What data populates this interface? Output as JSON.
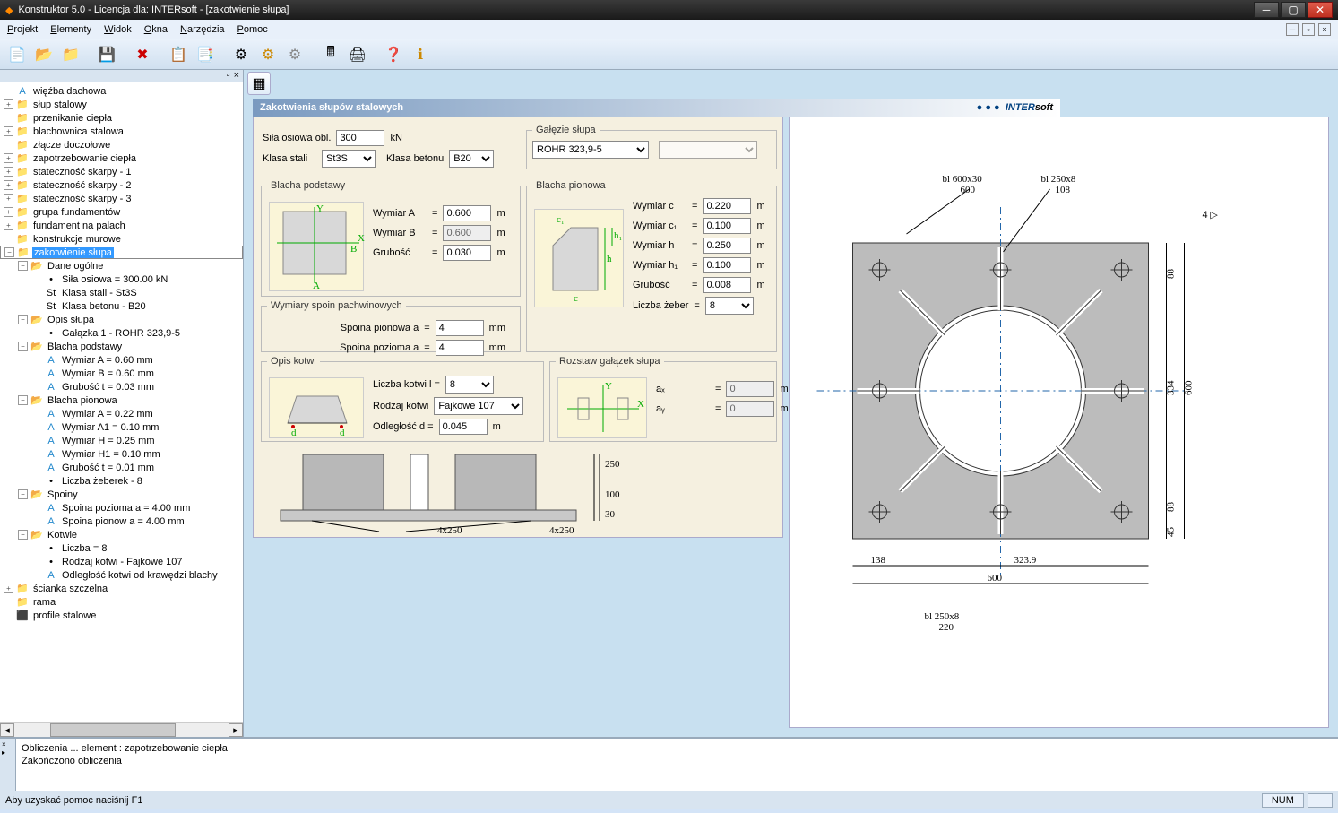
{
  "window": {
    "title": "Konstruktor 5.0 - Licencja dla: INTERsoft - [zakotwienie słupa]"
  },
  "menu": {
    "items": [
      "Projekt",
      "Elementy",
      "Widok",
      "Okna",
      "Narzędzia",
      "Pomoc"
    ]
  },
  "tree": {
    "items": [
      {
        "d": 0,
        "t": "",
        "i": "A",
        "l": "więźba dachowa"
      },
      {
        "d": 0,
        "t": "+",
        "i": "📁",
        "l": "słup stalowy"
      },
      {
        "d": 0,
        "t": "",
        "i": "📁",
        "l": "przenikanie ciepła"
      },
      {
        "d": 0,
        "t": "+",
        "i": "📁",
        "l": "blachownica stalowa"
      },
      {
        "d": 0,
        "t": "",
        "i": "📁",
        "l": "złącze doczołowe"
      },
      {
        "d": 0,
        "t": "+",
        "i": "📁",
        "l": "zapotrzebowanie ciepła"
      },
      {
        "d": 0,
        "t": "+",
        "i": "📁",
        "l": "stateczność skarpy - 1"
      },
      {
        "d": 0,
        "t": "+",
        "i": "📁",
        "l": "stateczność skarpy - 2"
      },
      {
        "d": 0,
        "t": "+",
        "i": "📁",
        "l": "stateczność skarpy - 3"
      },
      {
        "d": 0,
        "t": "+",
        "i": "📁",
        "l": "grupa fundamentów"
      },
      {
        "d": 0,
        "t": "+",
        "i": "📁",
        "l": "fundament na palach"
      },
      {
        "d": 0,
        "t": "",
        "i": "📁",
        "l": "konstrukcje murowe"
      },
      {
        "d": 0,
        "t": "−",
        "i": "📁",
        "l": "zakotwienie słupa",
        "sel": true
      },
      {
        "d": 1,
        "t": "−",
        "i": "📂",
        "l": "Dane ogólne"
      },
      {
        "d": 2,
        "t": "",
        "i": "•",
        "l": "Siła osiowa = 300.00 kN"
      },
      {
        "d": 2,
        "t": "",
        "i": "St",
        "l": "Klasa stali - St3S"
      },
      {
        "d": 2,
        "t": "",
        "i": "St",
        "l": "Klasa betonu - B20"
      },
      {
        "d": 1,
        "t": "−",
        "i": "📂",
        "l": "Opis słupa"
      },
      {
        "d": 2,
        "t": "",
        "i": "•",
        "l": "Gałązka 1 - ROHR 323,9-5"
      },
      {
        "d": 1,
        "t": "−",
        "i": "📂",
        "l": "Blacha podstawy"
      },
      {
        "d": 2,
        "t": "",
        "i": "A",
        "l": "Wymiar A = 0.60 mm"
      },
      {
        "d": 2,
        "t": "",
        "i": "A",
        "l": "Wymiar B = 0.60 mm"
      },
      {
        "d": 2,
        "t": "",
        "i": "A",
        "l": "Grubość t = 0.03 mm"
      },
      {
        "d": 1,
        "t": "−",
        "i": "📂",
        "l": "Blacha pionowa"
      },
      {
        "d": 2,
        "t": "",
        "i": "A",
        "l": "Wymiar A = 0.22 mm"
      },
      {
        "d": 2,
        "t": "",
        "i": "A",
        "l": "Wymiar A1 = 0.10 mm"
      },
      {
        "d": 2,
        "t": "",
        "i": "A",
        "l": "Wymiar H = 0.25 mm"
      },
      {
        "d": 2,
        "t": "",
        "i": "A",
        "l": "Wymiar H1 = 0.10 mm"
      },
      {
        "d": 2,
        "t": "",
        "i": "A",
        "l": "Grubość t = 0.01 mm"
      },
      {
        "d": 2,
        "t": "",
        "i": "•",
        "l": "Liczba żeberek - 8"
      },
      {
        "d": 1,
        "t": "−",
        "i": "📂",
        "l": "Spoiny"
      },
      {
        "d": 2,
        "t": "",
        "i": "A",
        "l": "Spoina pozioma a = 4.00 mm"
      },
      {
        "d": 2,
        "t": "",
        "i": "A",
        "l": "Spoina pionow a = 4.00 mm"
      },
      {
        "d": 1,
        "t": "−",
        "i": "📂",
        "l": "Kotwie"
      },
      {
        "d": 2,
        "t": "",
        "i": "•",
        "l": "Liczba = 8"
      },
      {
        "d": 2,
        "t": "",
        "i": "•",
        "l": "Rodzaj kotwi - Fajkowe 107"
      },
      {
        "d": 2,
        "t": "",
        "i": "A",
        "l": "Odległość kotwi od krawędzi blachy"
      },
      {
        "d": 0,
        "t": "+",
        "i": "📁",
        "l": "ścianka szczelna"
      },
      {
        "d": 0,
        "t": "",
        "i": "📁",
        "l": "rama"
      },
      {
        "d": 0,
        "t": "",
        "i": "⬛",
        "l": "profile stalowe"
      }
    ]
  },
  "panel": {
    "title": "Zakotwienia słupów stalowych",
    "brand1": "INTER",
    "brand2": "soft"
  },
  "form": {
    "sila_label": "Siła osiowa obl.",
    "sila_val": "300",
    "sila_unit": "kN",
    "klasa_stali_label": "Klasa stali",
    "klasa_stali_val": "St3S",
    "klasa_betonu_label": "Klasa betonu",
    "klasa_betonu_val": "B20",
    "galezie_label": "Gałęzie słupa",
    "galezie_val": "ROHR 323,9-5",
    "blacha_podstawy": "Blacha podstawy",
    "wymiar_a_label": "Wymiar A",
    "wymiar_a_val": "0.600",
    "wymiar_a_unit": "m",
    "wymiar_b_label": "Wymiar B",
    "wymiar_b_val": "0.600",
    "wymiar_b_unit": "m",
    "grubosc_label": "Grubość",
    "grubosc_val": "0.030",
    "grubosc_unit": "m",
    "blacha_pionowa": "Blacha pionowa",
    "wymiar_c_label": "Wymiar c",
    "wymiar_c_val": "0.220",
    "wymiar_c1_label": "Wymiar c₁",
    "wymiar_c1_val": "0.100",
    "wymiar_h_label": "Wymiar h",
    "wymiar_h_val": "0.250",
    "wymiar_h1_label": "Wymiar h₁",
    "wymiar_h1_val": "0.100",
    "grubosc2_val": "0.008",
    "liczba_zeber_label": "Liczba żeber",
    "liczba_zeber_val": "8",
    "spoiny_label": "Wymiary spoin pachwinowych",
    "spoina_pion_label": "Spoina pionowa a",
    "spoina_pion_val": "4",
    "spoina_unit": "mm",
    "spoina_poz_label": "Spoina pozioma a",
    "spoina_poz_val": "4",
    "opis_kotwi": "Opis kotwi",
    "liczba_kotwi_label": "Liczba kotwi l =",
    "liczba_kotwi_val": "8",
    "rodzaj_kotwi_label": "Rodzaj kotwi",
    "rodzaj_kotwi_val": "Fajkowe 107",
    "odleglosc_label": "Odległość d =",
    "odleglosc_val": "0.045",
    "odleglosc_unit": "m",
    "rozstaw_label": "Rozstaw gałązek słupa",
    "ax_label": "aₓ",
    "ax_val": "0",
    "ay_label": "aᵧ",
    "ay_val": "0",
    "eq": "="
  },
  "drawing": {
    "top_bl600": "bl 600x30",
    "top_600": "600",
    "top_bl250": "bl 250x8",
    "top_108": "108",
    "top_4": "4",
    "dim_88": "88",
    "dim_334": "334",
    "dim_600": "600",
    "dim_45": "45",
    "dim_138": "138",
    "dim_3239": "323.9",
    "left_250": "250",
    "left_100": "100",
    "left_30": "30",
    "left_4x250": "4x250",
    "left_bl250": "bl 250x8",
    "left_220": "220"
  },
  "output": {
    "line1": "Obliczenia ... element : zapotrzebowanie ciepła",
    "line2": "Zakończono obliczenia"
  },
  "status": {
    "help": "Aby uzyskać pomoc naciśnij F1",
    "num": "NUM"
  }
}
